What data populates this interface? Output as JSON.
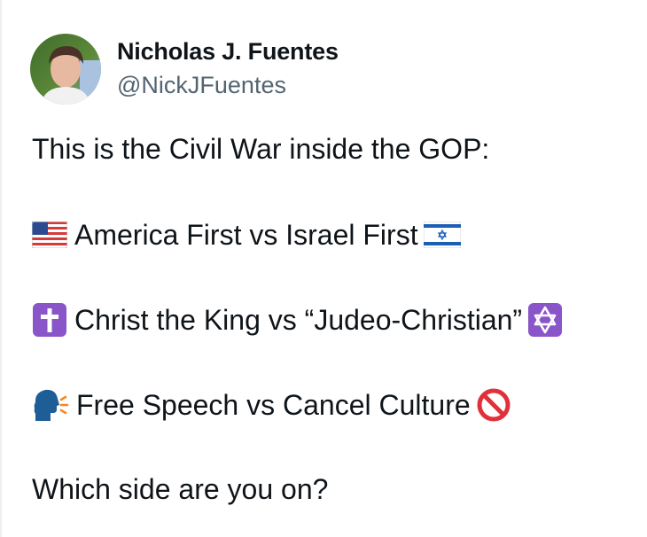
{
  "author": {
    "display_name": "Nicholas J. Fuentes",
    "handle": "@NickJFuentes"
  },
  "tweet": {
    "intro": "This is the Civil War inside the GOP:",
    "item1": {
      "left_emoji": "us-flag-icon",
      "text": "America First vs Israel First",
      "right_emoji": "israel-flag-icon"
    },
    "item2": {
      "left_emoji": "latin-cross-icon",
      "text": "Christ the King vs “Judeo-Christian”",
      "right_emoji": "star-of-david-icon"
    },
    "item3": {
      "left_emoji": "speaking-head-icon",
      "text": "Free Speech vs Cancel Culture",
      "right_emoji": "prohibited-icon"
    },
    "closing": "Which side are you on?"
  },
  "colors": {
    "text": "#0f1419",
    "handle": "#536471",
    "purple_emoji": "#8a55c8",
    "prohibited_red": "#e0313b",
    "israel_blue": "#1a5fb4"
  }
}
